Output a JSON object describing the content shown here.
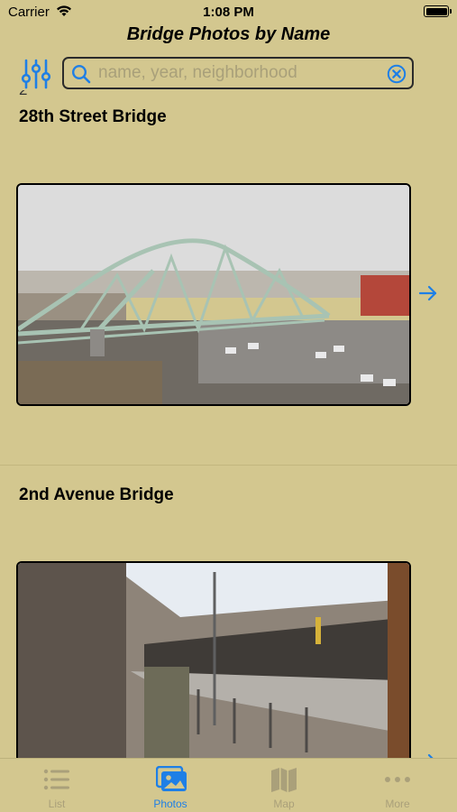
{
  "status_bar": {
    "carrier": "Carrier",
    "time": "1:08 PM"
  },
  "nav": {
    "title": "Bridge Photos by Name"
  },
  "search": {
    "placeholder": "name, year, neighborhood",
    "value": ""
  },
  "list": {
    "section_index": "2",
    "items": [
      {
        "title": "28th Street Bridge"
      },
      {
        "title": "2nd Avenue Bridge"
      }
    ]
  },
  "tabs": [
    {
      "label": "List",
      "icon": "list-icon"
    },
    {
      "label": "Photos",
      "icon": "photos-icon"
    },
    {
      "label": "Map",
      "icon": "map-icon"
    },
    {
      "label": "More",
      "icon": "more-icon"
    }
  ],
  "colors": {
    "background": "#d3c78f",
    "accent": "#1e7fe6",
    "inactive": "#aaa07a"
  }
}
